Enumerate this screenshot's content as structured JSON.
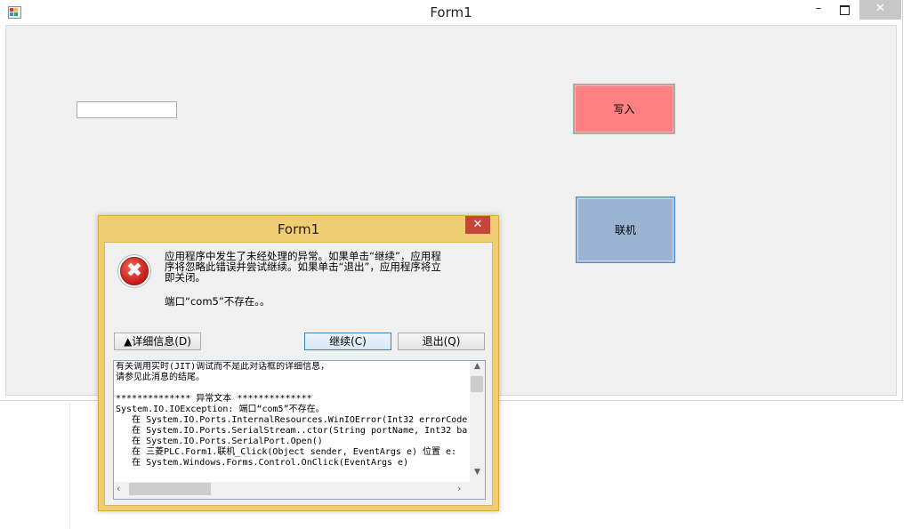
{
  "main_window": {
    "title": "Form1",
    "minimize_glyph": "–",
    "close_glyph": "✕",
    "input_value": "",
    "write_button": "写入",
    "connect_button": "联机"
  },
  "dialog": {
    "title": "Form1",
    "close_glyph": "✕",
    "icon_glyph": "✖",
    "message_line1": "应用程序中发生了未经处理的异常。如果单击“继续”，应用程",
    "message_line2": "序将忽略此错误并尝试继续。如果单击“退出”，应用程序将立",
    "message_line3": "即关闭。",
    "port_message": "端口“com5”不存在。。",
    "details_button": "▲详细信息(D)",
    "continue_button": "继续(C)",
    "quit_button": "退出(Q)",
    "details_text": "有关调用实时(JIT)调试而不是此对话框的详细信息，\n请参见此消息的结尾。\n\n************** 异常文本 **************\nSystem.IO.IOException: 端口“com5”不存在。\n   在 System.IO.Ports.InternalResources.WinIOError(Int32 errorCode\n   在 System.IO.Ports.SerialStream..ctor(String portName, Int32 ba\n   在 System.IO.Ports.SerialPort.Open()\n   在 三菱PLC.Form1.联机_Click(Object sender, EventArgs e) 位置 e:\n   在 System.Windows.Forms.Control.OnClick(EventArgs e)"
  }
}
